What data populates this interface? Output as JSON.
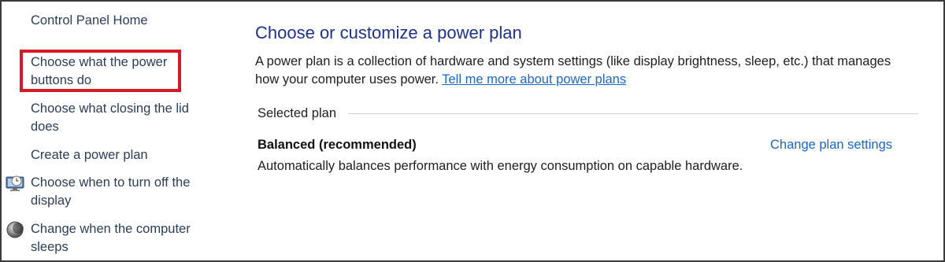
{
  "sidebar": {
    "home": "Control Panel Home",
    "power_buttons": "Choose what the power buttons do",
    "closing_lid": "Choose what closing the lid does",
    "create_plan": "Create a power plan",
    "turn_off_display": "Choose when to turn off the display",
    "computer_sleeps": "Change when the computer sleeps"
  },
  "main": {
    "title": "Choose or customize a power plan",
    "description": "A power plan is a collection of hardware and system settings (like display brightness, sleep, etc.) that manages how your computer uses power.",
    "tell_me_more_link": "Tell me more about power plans",
    "selected_plan_label": "Selected plan",
    "plan": {
      "name": "Balanced (recommended)",
      "change_settings_link": "Change plan settings",
      "description": "Automatically balances performance with energy consumption on capable hardware."
    }
  },
  "icons": {
    "display": "monitor-clock-icon",
    "sleep": "moon-sleep-icon"
  },
  "colors": {
    "link": "#1b67c2",
    "title": "#1e3287",
    "highlight": "#d41a26",
    "sidebar_text": "#2b3e57"
  }
}
